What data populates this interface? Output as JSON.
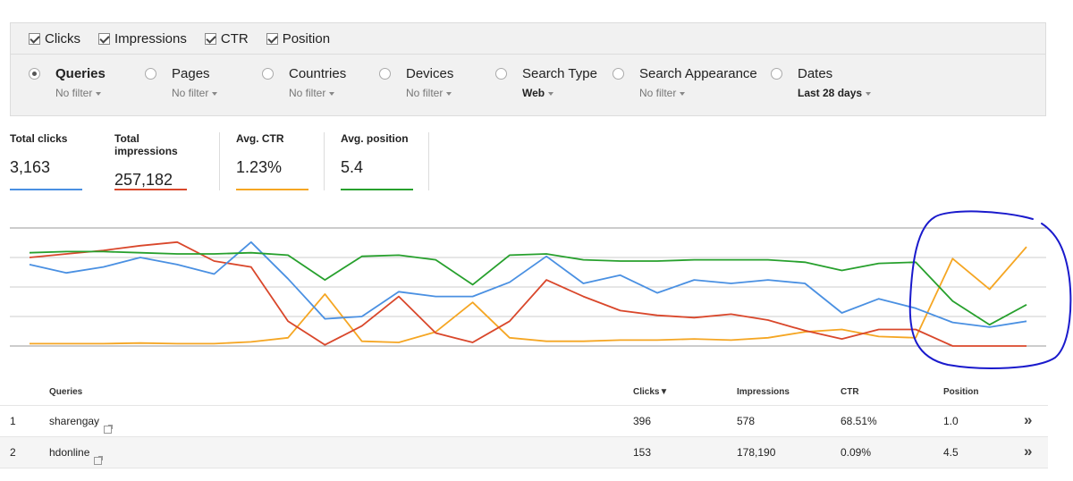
{
  "metrics": [
    {
      "label": "Clicks",
      "checked": true
    },
    {
      "label": "Impressions",
      "checked": true
    },
    {
      "label": "CTR",
      "checked": true
    },
    {
      "label": "Position",
      "checked": true
    }
  ],
  "filters": [
    {
      "label": "Queries",
      "sub": "No filter",
      "selected": true
    },
    {
      "label": "Pages",
      "sub": "No filter",
      "selected": false
    },
    {
      "label": "Countries",
      "sub": "No filter",
      "selected": false
    },
    {
      "label": "Devices",
      "sub": "No filter",
      "selected": false
    },
    {
      "label": "Search Type",
      "sub": "Web",
      "selected": false
    },
    {
      "label": "Search Appearance",
      "sub": "No filter",
      "selected": false
    },
    {
      "label": "Dates",
      "sub": "Last 28 days",
      "selected": false
    }
  ],
  "totals": [
    {
      "label": "Total clicks",
      "value": "3,163",
      "color": "#4a90e2"
    },
    {
      "label": "Total impressions",
      "value": "257,182",
      "color": "#d9472b"
    },
    {
      "label": "Avg. CTR",
      "value": "1.23%",
      "color": "#f5a623"
    },
    {
      "label": "Avg. position",
      "value": "5.4",
      "color": "#27a02d"
    }
  ],
  "chart_data": {
    "type": "line",
    "x": [
      1,
      2,
      3,
      4,
      5,
      6,
      7,
      8,
      9,
      10,
      11,
      12,
      13,
      14,
      15,
      16,
      17,
      18,
      19,
      20,
      21,
      22,
      23,
      24,
      25,
      26,
      27,
      28
    ],
    "ylim": [
      0,
      100
    ],
    "grid": true,
    "series": [
      {
        "color": "#4a90e2",
        "values": [
          69,
          62,
          67,
          75,
          69,
          61,
          88,
          57,
          23,
          25,
          46,
          42,
          42,
          54,
          76,
          53,
          60,
          45,
          56,
          53,
          56,
          53,
          28,
          40,
          32,
          20,
          16,
          21
        ]
      },
      {
        "color": "#d9472b",
        "values": [
          75,
          78,
          81,
          85,
          88,
          72,
          67,
          21,
          1,
          17,
          42,
          11,
          3,
          21,
          56,
          42,
          30,
          26,
          24,
          27,
          22,
          13,
          6,
          14,
          14,
          0,
          0,
          0
        ]
      },
      {
        "color": "#f5a623",
        "values": [
          2,
          2,
          2,
          2.5,
          2,
          2,
          3.5,
          7,
          44,
          4,
          3,
          12,
          37,
          7,
          4,
          4,
          5,
          5,
          6,
          5,
          7,
          12,
          14,
          8,
          7,
          74,
          48,
          84
        ]
      },
      {
        "color": "#27a02d",
        "values": [
          79,
          80,
          80,
          79,
          78,
          78,
          79,
          77,
          56,
          76,
          77,
          73,
          52,
          77,
          78,
          73,
          72,
          72,
          73,
          73,
          73,
          71,
          64,
          70,
          71,
          38,
          18,
          35
        ]
      }
    ]
  },
  "annotation_color": "#1a1acc",
  "table": {
    "headers": {
      "query": "Queries",
      "clicks": "Clicks",
      "clicks_sort": "▼",
      "impressions": "Impressions",
      "ctr": "CTR",
      "position": "Position"
    },
    "rows": [
      {
        "num": "1",
        "query": "sharengay",
        "clicks": "396",
        "impressions": "578",
        "ctr": "68.51%",
        "position": "1.0",
        "more": "»"
      },
      {
        "num": "2",
        "query": "hdonline",
        "clicks": "153",
        "impressions": "178,190",
        "ctr": "0.09%",
        "position": "4.5",
        "more": "»"
      }
    ]
  }
}
